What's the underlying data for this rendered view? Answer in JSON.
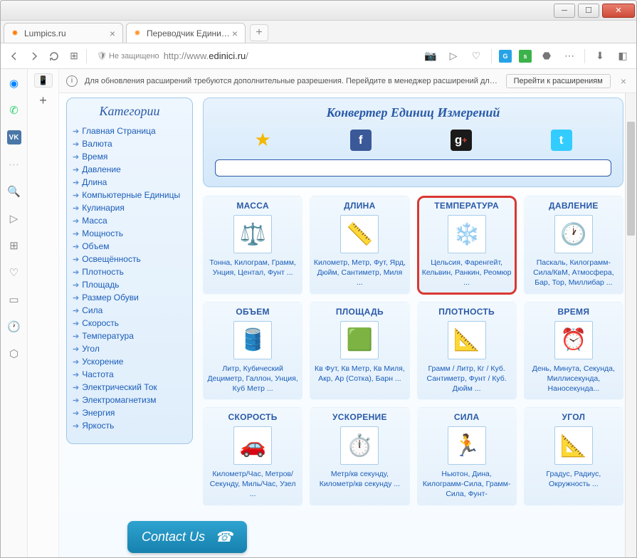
{
  "window": {
    "tabs": [
      {
        "title": "Lumpics.ru",
        "favicon_color": "#ff7b00",
        "active": false
      },
      {
        "title": "Переводчик Единиц Изме",
        "favicon_color": "#ff9933",
        "active": true
      }
    ]
  },
  "addressbar": {
    "security_label": "Не защищено",
    "url_prefix": "http://www.",
    "url_host": "edinici.ru",
    "url_path": "/"
  },
  "notification": {
    "message": "Для обновления расширений требуются дополнительные разрешения. Перейдите в менеджер расширений для под…",
    "action": "Перейти к расширениям"
  },
  "categories": {
    "title": "Категории",
    "items": [
      "Главная Страница",
      "Валюта",
      "Время",
      "Давление",
      "Длина",
      "Компьютерные Единицы",
      "Кулинария",
      "Масса",
      "Мощность",
      "Объем",
      "Освещённость",
      "Плотность",
      "Площадь",
      "Размер Обуви",
      "Сила",
      "Скорость",
      "Температура",
      "Угол",
      "Ускорение",
      "Частота",
      "Электрический Ток",
      "Электромагнетизм",
      "Энергия",
      "Яркость"
    ]
  },
  "converter": {
    "title": "Конвертер Единиц Измерений"
  },
  "cards": [
    {
      "title": "МАССА",
      "desc": "Тонна, Килограм, Грамм, Унция, Центал, Фунт ...",
      "icon": "⚖️"
    },
    {
      "title": "ДЛИНА",
      "desc": "Километр, Метр, Фут, Ярд, Дюйм, Сантиметр, Миля ...",
      "icon": "📏"
    },
    {
      "title": "ТЕМПЕРАТУРА",
      "desc": "Цельсия, Фаренгейт, Кельвин, Ранкин, Реомюр ...",
      "icon": "❄️",
      "highlight": true
    },
    {
      "title": "ДАВЛЕНИЕ",
      "desc": "Паскаль, Килограмм-Сила/КвМ, Атмосфера, Бар, Тор, Миллибар ...",
      "icon": "🕐"
    },
    {
      "title": "ОБЪЕМ",
      "desc": "Литр, Кубический Дециметр, Галлон, Унция, Куб Метр ...",
      "icon": "🛢️"
    },
    {
      "title": "ПЛОЩАДЬ",
      "desc": "Кв Фут, Кв Метр, Кв Миля, Акр, Ар (Сотка), Барн ...",
      "icon": "🟩"
    },
    {
      "title": "ПЛОТНОСТЬ",
      "desc": "Грамм / Литр, Кг / Куб. Сантиметр, Фунт / Куб. Дюйм ...",
      "icon": "📐"
    },
    {
      "title": "ВРЕМЯ",
      "desc": "День, Минута, Секунда, Миллисекунда, Наносекунда...",
      "icon": "⏰"
    },
    {
      "title": "СКОРОСТЬ",
      "desc": "Километр/Час, Метров/Секунду, Миль/Час, Узел ...",
      "icon": "🚗"
    },
    {
      "title": "УСКОРЕНИЕ",
      "desc": "Метр/кв секунду, Километр/кв секунду ...",
      "icon": "⏱️"
    },
    {
      "title": "СИЛА",
      "desc": "Ньютон, Дина, Килограмм-Сила, Грамм-Сила, Фунт-",
      "icon": "🏃"
    },
    {
      "title": "УГОЛ",
      "desc": "Градус, Радиус, Окружность ...",
      "icon": "📐"
    }
  ],
  "contact": {
    "label": "Contact Us"
  }
}
